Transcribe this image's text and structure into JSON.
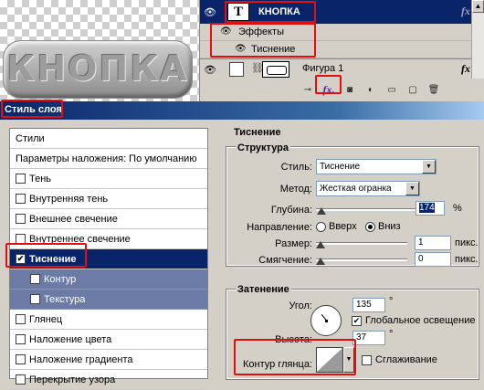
{
  "canvas": {
    "button_text": "КНОПКА"
  },
  "layers": {
    "text_layer": {
      "name": "КНОПКА",
      "thumb": "T",
      "fx": "fx"
    },
    "effects": {
      "label": "Эффекты"
    },
    "effect_item": {
      "label": "Тиснение"
    },
    "shape_layer": {
      "name": "Фигура 1",
      "fx": "fx"
    },
    "toolbar_fx": "fx."
  },
  "dialog": {
    "title": "Стиль слоя",
    "styles_header": "Стили",
    "blend_options": "Параметры наложения: По умолчанию",
    "items": [
      {
        "label": "Тень",
        "checked": false
      },
      {
        "label": "Внутренняя тень",
        "checked": false
      },
      {
        "label": "Внешнее свечение",
        "checked": false
      },
      {
        "label": "Внутреннее свечение",
        "checked": false
      },
      {
        "label": "Тиснение",
        "checked": true
      },
      {
        "label": "Контур",
        "checked": false
      },
      {
        "label": "Текстура",
        "checked": false
      },
      {
        "label": "Глянец",
        "checked": false
      },
      {
        "label": "Наложение цвета",
        "checked": false
      },
      {
        "label": "Наложение градиента",
        "checked": false
      },
      {
        "label": "Перекрытие узора",
        "checked": false
      }
    ],
    "bevel": {
      "section_title": "Тиснение",
      "structure_title": "Структура",
      "style_label": "Стиль:",
      "style_value": "Тиснение",
      "technique_label": "Метод:",
      "technique_value": "Жесткая огранка",
      "depth_label": "Глубина:",
      "depth_value": "174",
      "depth_unit": "%",
      "direction_label": "Направление:",
      "dir_up": "Вверх",
      "dir_down": "Вниз",
      "size_label": "Размер:",
      "size_value": "1",
      "size_unit": "пикс.",
      "soften_label": "Смягчение:",
      "soften_value": "0",
      "soften_unit": "пикс."
    },
    "shading": {
      "title": "Затенение",
      "angle_label": "Угол:",
      "angle_value": "135",
      "angle_unit": "°",
      "global_light": "Глобальное освещение",
      "altitude_label": "Высота:",
      "altitude_value": "37",
      "altitude_unit": "°",
      "gloss_label": "Контур глянца:",
      "antialias": "Сглаживание"
    }
  },
  "colors": {
    "highlight": "#e01010",
    "selection": "#0a246a"
  }
}
